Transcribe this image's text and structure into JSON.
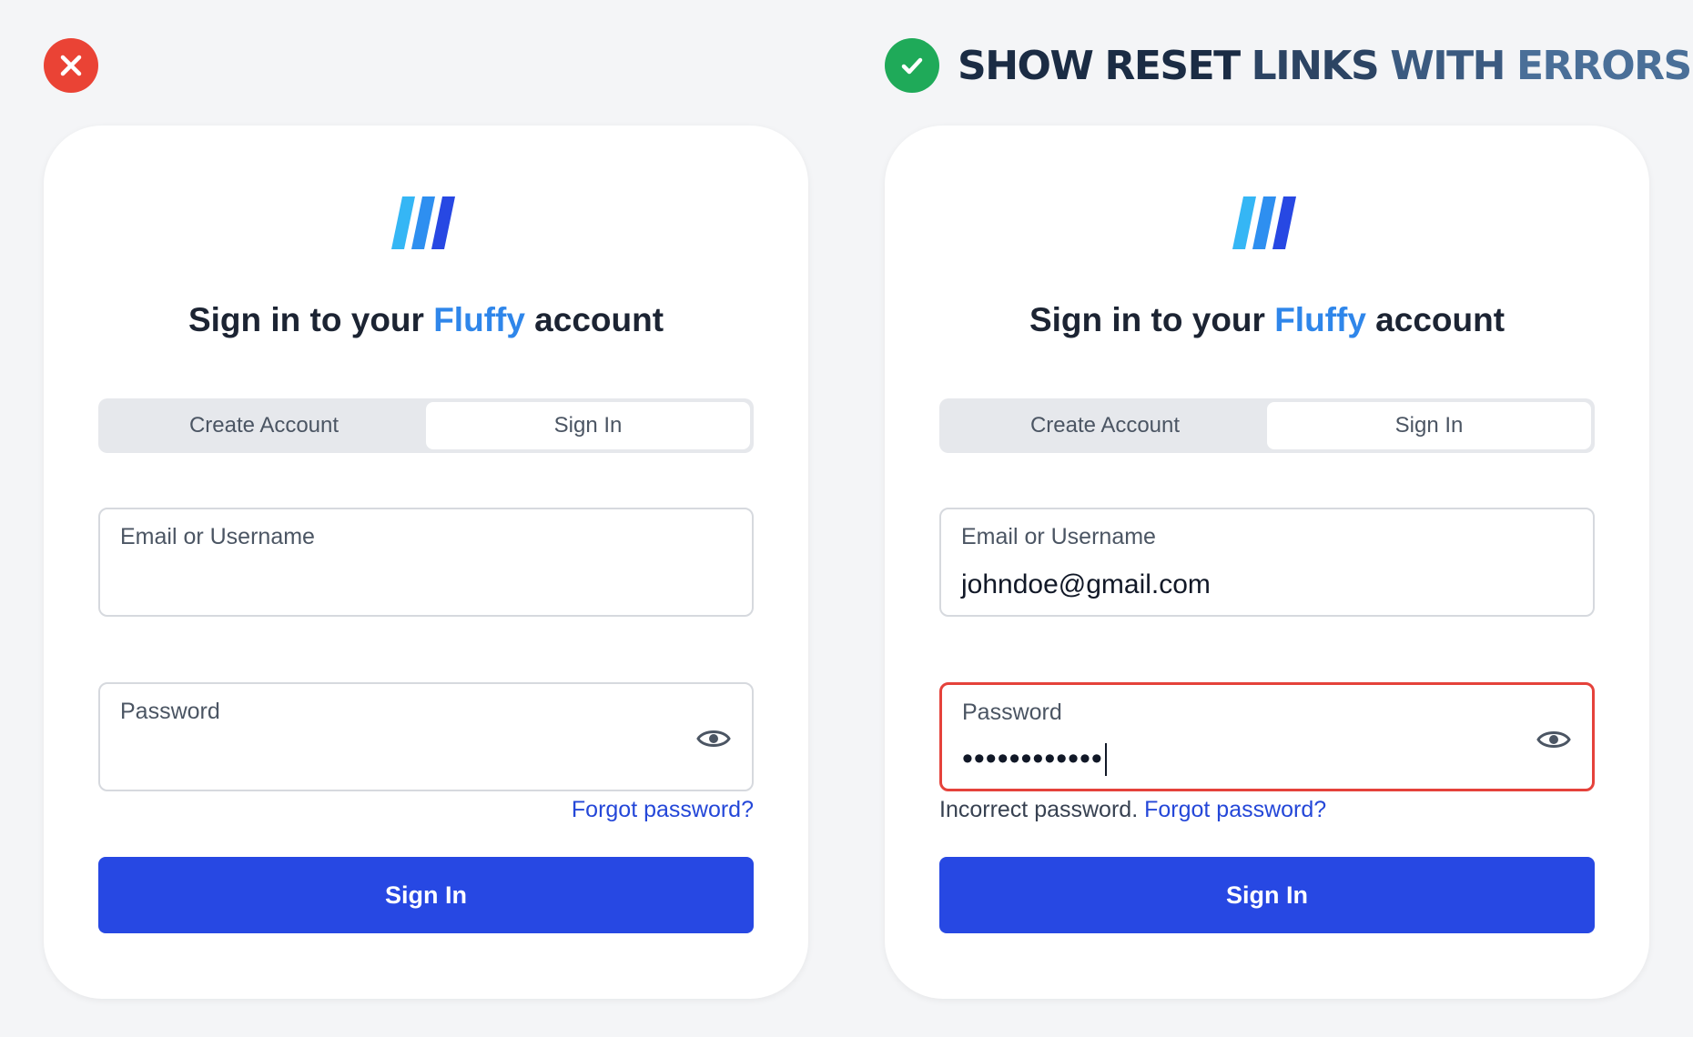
{
  "headline": {
    "words": [
      "SHOW",
      "RESET",
      "LINKS",
      "WITH",
      "ERRORS"
    ],
    "colors": [
      "#1b2c44",
      "#1b2c44",
      "#2c4463",
      "#3b5a80",
      "#4a6f98"
    ]
  },
  "badges": {
    "bad_icon": "close-icon",
    "good_icon": "checkmark-icon",
    "bad_color": "#ea4335",
    "good_color": "#1faa59"
  },
  "logo_colors": [
    "#35b6f5",
    "#2e8ff0",
    "#2748e3"
  ],
  "left_panel": {
    "title_prefix": "Sign in to your ",
    "title_brand": "Fluffy",
    "title_suffix": " account",
    "tab_create": "Create Account",
    "tab_signin": "Sign In",
    "email_label": "Email or Username",
    "email_value": "",
    "password_label": "Password",
    "password_value": "",
    "forgot_link": "Forgot password?",
    "submit_label": "Sign In"
  },
  "right_panel": {
    "title_prefix": "Sign in to your ",
    "title_brand": "Fluffy",
    "title_suffix": " account",
    "tab_create": "Create Account",
    "tab_signin": "Sign In",
    "email_label": "Email or Username",
    "email_value": "johndoe@gmail.com",
    "password_label": "Password",
    "password_value": "••••••••••••",
    "error_text": "Incorrect password.",
    "forgot_link": "Forgot password?",
    "submit_label": "Sign In"
  },
  "colors": {
    "brand": "#2f86ea",
    "primary_button": "#2748e3",
    "link": "#2447d8",
    "error_border": "#e5423b"
  }
}
